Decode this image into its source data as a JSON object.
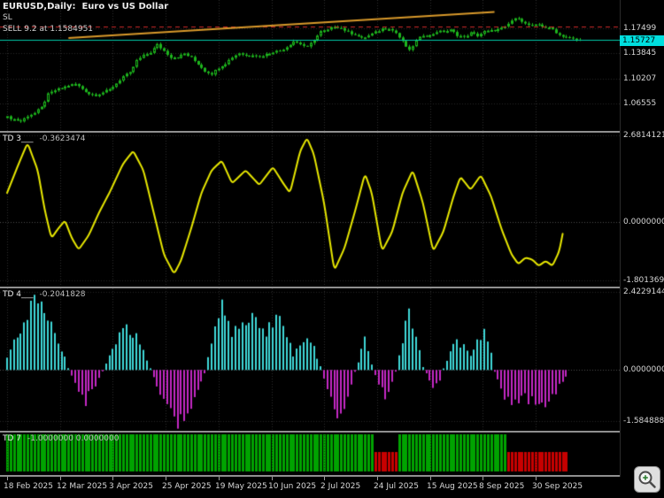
{
  "main_chart": {
    "title": "EURUSD,Daily:  Euro vs US Dollar",
    "sl_label": "SL",
    "trade_label": "SELL 9.2 at 1.1584951",
    "price_scale": {
      "labels": [
        "1.17499",
        "1.13845",
        "1.10207",
        "1.06555"
      ],
      "current": "1.15727"
    }
  },
  "indicators": {
    "td3": {
      "name": "TD 3___",
      "value": "-0.3623474",
      "scale_labels": [
        "2.6814121",
        "0.0000000",
        "-1.8013699"
      ]
    },
    "td4": {
      "name": "TD 4___",
      "value": "-0.2041828",
      "scale_labels": [
        "2.4229144",
        "0.0000000",
        "-1.5848888"
      ]
    },
    "td7": {
      "name": "TD 7",
      "values_text": "-1.0000000 0.0000000"
    }
  },
  "time_axis": {
    "labels": [
      "18 Feb 2025",
      "12 Mar 2025",
      "3 Apr 2025",
      "25 Apr 2025",
      "19 May 2025",
      "10 Jun 2025",
      "2 Jul 2025",
      "24 Jul 2025",
      "15 Aug 2025",
      "8 Sep 2025",
      "30 Sep 2025"
    ]
  },
  "zoom_button": {
    "icon": "magnifier-plus"
  },
  "chart_data": [
    {
      "id": "eurusd",
      "type": "candlestick",
      "title": "EURUSD Daily - Euro vs US Dollar",
      "n_bars": 169,
      "y_range": [
        1.0261,
        1.2157
      ],
      "y_tick_labels": [
        1.17499,
        1.13845,
        1.10207,
        1.06555
      ],
      "last_close": 1.15727,
      "close_anchors": [
        [
          0,
          1.046
        ],
        [
          2,
          1.043
        ],
        [
          4,
          1.04
        ],
        [
          6,
          1.048
        ],
        [
          8,
          1.052
        ],
        [
          10,
          1.06
        ],
        [
          12,
          1.079
        ],
        [
          14,
          1.085
        ],
        [
          16,
          1.088
        ],
        [
          18,
          1.092
        ],
        [
          20,
          1.094
        ],
        [
          22,
          1.087
        ],
        [
          24,
          1.08
        ],
        [
          26,
          1.078
        ],
        [
          28,
          1.082
        ],
        [
          30,
          1.086
        ],
        [
          32,
          1.095
        ],
        [
          34,
          1.105
        ],
        [
          36,
          1.11
        ],
        [
          38,
          1.128
        ],
        [
          40,
          1.135
        ],
        [
          42,
          1.14
        ],
        [
          44,
          1.151
        ],
        [
          46,
          1.142
        ],
        [
          48,
          1.133
        ],
        [
          50,
          1.133
        ],
        [
          52,
          1.138
        ],
        [
          54,
          1.132
        ],
        [
          56,
          1.123
        ],
        [
          58,
          1.113
        ],
        [
          60,
          1.109
        ],
        [
          62,
          1.118
        ],
        [
          64,
          1.124
        ],
        [
          66,
          1.133
        ],
        [
          68,
          1.139
        ],
        [
          70,
          1.135
        ],
        [
          72,
          1.137
        ],
        [
          74,
          1.134
        ],
        [
          76,
          1.137
        ],
        [
          78,
          1.141
        ],
        [
          80,
          1.142
        ],
        [
          82,
          1.148
        ],
        [
          84,
          1.156
        ],
        [
          86,
          1.152
        ],
        [
          88,
          1.147
        ],
        [
          90,
          1.158
        ],
        [
          92,
          1.17
        ],
        [
          94,
          1.172
        ],
        [
          96,
          1.178
        ],
        [
          98,
          1.175
        ],
        [
          100,
          1.169
        ],
        [
          102,
          1.166
        ],
        [
          104,
          1.16
        ],
        [
          106,
          1.164
        ],
        [
          108,
          1.169
        ],
        [
          110,
          1.174
        ],
        [
          112,
          1.175
        ],
        [
          114,
          1.168
        ],
        [
          116,
          1.155
        ],
        [
          118,
          1.142
        ],
        [
          120,
          1.157
        ],
        [
          122,
          1.165
        ],
        [
          124,
          1.164
        ],
        [
          126,
          1.17
        ],
        [
          128,
          1.17
        ],
        [
          130,
          1.172
        ],
        [
          132,
          1.165
        ],
        [
          134,
          1.162
        ],
        [
          136,
          1.168
        ],
        [
          138,
          1.164
        ],
        [
          140,
          1.17
        ],
        [
          142,
          1.171
        ],
        [
          144,
          1.173
        ],
        [
          146,
          1.176
        ],
        [
          148,
          1.186
        ],
        [
          150,
          1.19
        ],
        [
          152,
          1.181
        ],
        [
          154,
          1.178
        ],
        [
          156,
          1.18
        ],
        [
          158,
          1.176
        ],
        [
          160,
          1.173
        ],
        [
          162,
          1.165
        ],
        [
          164,
          1.162
        ],
        [
          166,
          1.159
        ],
        [
          168,
          1.15727
        ]
      ],
      "overlays": [
        {
          "name": "stop-loss-line",
          "kind": "hline",
          "price": 1.1772,
          "color": "#cc2a2a",
          "dash": [
            5,
            4
          ]
        },
        {
          "name": "sell-order-line",
          "kind": "hline",
          "price": 1.1584951,
          "color": "#00c8a8"
        },
        {
          "name": "trendline",
          "kind": "segment",
          "from": [
            18,
            1.1605
          ],
          "to": [
            143,
            1.1985
          ],
          "color": "#d99a2b",
          "width": 2
        }
      ],
      "colors": {
        "up": "#1db51d",
        "wick": "#1db51d"
      }
    },
    {
      "id": "td3",
      "type": "line",
      "name": "TD 3",
      "current_value": -0.3623474,
      "y_range": [
        -1.9927,
        2.7634
      ],
      "y_ticks": [
        2.6814121,
        0,
        -1.8013699
      ],
      "color": "#e8e800",
      "width": 2,
      "anchors": [
        [
          0,
          0.9
        ],
        [
          3,
          1.7
        ],
        [
          6,
          2.45
        ],
        [
          9,
          1.6
        ],
        [
          11,
          0.4
        ],
        [
          13,
          -0.5
        ],
        [
          15,
          -0.2
        ],
        [
          17,
          0.05
        ],
        [
          19,
          -0.5
        ],
        [
          21,
          -0.85
        ],
        [
          24,
          -0.4
        ],
        [
          27,
          0.3
        ],
        [
          30,
          0.9
        ],
        [
          34,
          1.8
        ],
        [
          37,
          2.2
        ],
        [
          40,
          1.6
        ],
        [
          43,
          0.3
        ],
        [
          46,
          -1.0
        ],
        [
          49,
          -1.6
        ],
        [
          51,
          -1.2
        ],
        [
          54,
          -0.2
        ],
        [
          57,
          0.9
        ],
        [
          60,
          1.6
        ],
        [
          63,
          1.9
        ],
        [
          66,
          1.2
        ],
        [
          70,
          1.6
        ],
        [
          74,
          1.15
        ],
        [
          78,
          1.7
        ],
        [
          81,
          1.2
        ],
        [
          83,
          0.9
        ],
        [
          86,
          2.2
        ],
        [
          88,
          2.6
        ],
        [
          90,
          2.1
        ],
        [
          93,
          0.6
        ],
        [
          96,
          -1.5
        ],
        [
          99,
          -0.8
        ],
        [
          102,
          0.3
        ],
        [
          105,
          1.5
        ],
        [
          107,
          0.9
        ],
        [
          110,
          -0.9
        ],
        [
          113,
          -0.3
        ],
        [
          116,
          0.9
        ],
        [
          119,
          1.6
        ],
        [
          122,
          0.6
        ],
        [
          125,
          -0.9
        ],
        [
          128,
          -0.3
        ],
        [
          131,
          0.8
        ],
        [
          133,
          1.4
        ],
        [
          136,
          1.0
        ],
        [
          139,
          1.45
        ],
        [
          142,
          0.8
        ],
        [
          145,
          -0.2
        ],
        [
          148,
          -1.0
        ],
        [
          150,
          -1.3
        ],
        [
          152,
          -1.1
        ],
        [
          154,
          -1.15
        ],
        [
          156,
          -1.35
        ],
        [
          158,
          -1.2
        ],
        [
          160,
          -1.35
        ],
        [
          162,
          -0.9
        ],
        [
          163,
          -0.3623474
        ]
      ]
    },
    {
      "id": "td4",
      "type": "bar",
      "name": "TD 4",
      "current_value": -0.2041828,
      "y_range": [
        -1.8869,
        2.5327
      ],
      "y_ticks": [
        2.4229144,
        0,
        -1.5848888
      ],
      "pos_color": "#3fd8d8",
      "neg_color": "#c428c4",
      "anchors": [
        [
          0,
          0.4
        ],
        [
          4,
          1.3
        ],
        [
          9,
          2.4
        ],
        [
          13,
          1.6
        ],
        [
          18,
          0.05
        ],
        [
          20,
          -0.4
        ],
        [
          23,
          -0.95
        ],
        [
          26,
          -0.5
        ],
        [
          28,
          -0.05
        ],
        [
          31,
          0.7
        ],
        [
          35,
          1.5
        ],
        [
          39,
          0.8
        ],
        [
          42,
          0.05
        ],
        [
          45,
          -0.8
        ],
        [
          50,
          -1.55
        ],
        [
          54,
          -1.2
        ],
        [
          58,
          -0.1
        ],
        [
          60,
          0.8
        ],
        [
          63,
          1.9
        ],
        [
          66,
          1.1
        ],
        [
          69,
          1.4
        ],
        [
          72,
          1.6
        ],
        [
          76,
          1.2
        ],
        [
          80,
          1.7
        ],
        [
          84,
          0.5
        ],
        [
          87,
          0.8
        ],
        [
          89,
          1.0
        ],
        [
          92,
          0.1
        ],
        [
          94,
          -0.6
        ],
        [
          97,
          -1.3
        ],
        [
          100,
          -0.9
        ],
        [
          102,
          -0.05
        ],
        [
          104,
          0.6
        ],
        [
          105,
          0.9
        ],
        [
          107,
          0.2
        ],
        [
          109,
          -0.5
        ],
        [
          111,
          -0.8
        ],
        [
          113,
          -0.4
        ],
        [
          114,
          -0.05
        ],
        [
          116,
          0.9
        ],
        [
          118,
          1.7
        ],
        [
          120,
          1.1
        ],
        [
          122,
          0.1
        ],
        [
          124,
          -0.35
        ],
        [
          125,
          -0.5
        ],
        [
          127,
          -0.3
        ],
        [
          128,
          0.05
        ],
        [
          130,
          0.5
        ],
        [
          132,
          0.9
        ],
        [
          136,
          0.5
        ],
        [
          140,
          1.2
        ],
        [
          142,
          0.6
        ],
        [
          143,
          -0.05
        ],
        [
          145,
          -0.6
        ],
        [
          147,
          -1.0
        ],
        [
          150,
          -0.9
        ],
        [
          152,
          -0.85
        ],
        [
          156,
          -1.1
        ],
        [
          159,
          -0.95
        ],
        [
          162,
          -0.5
        ],
        [
          164,
          -0.2041828
        ]
      ]
    },
    {
      "id": "td7",
      "type": "blocks",
      "name": "TD 7",
      "current_values": [
        -1,
        0
      ],
      "segments": [
        {
          "from": 0,
          "to": 107,
          "state": 1
        },
        {
          "from": 108,
          "to": 114,
          "state": -1
        },
        {
          "from": 115,
          "to": 146,
          "state": 1
        },
        {
          "from": 147,
          "to": 164,
          "state": -1
        }
      ],
      "colors": {
        "up": "#00a300",
        "down": "#c80000"
      }
    }
  ]
}
